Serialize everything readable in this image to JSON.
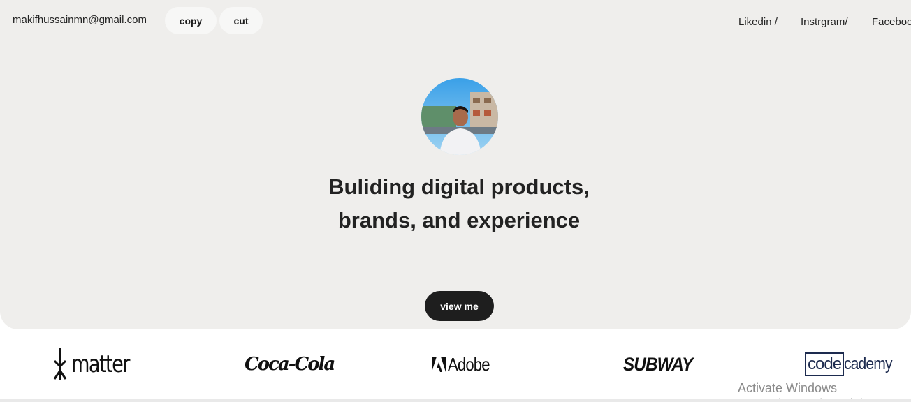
{
  "header": {
    "email": "makifhussainmn@gmail.com",
    "copy_label": "copy",
    "cut_label": "cut",
    "social": {
      "linkedin": "Likedin /",
      "instagram": "Instrgram/",
      "facebook": "Facebook"
    }
  },
  "hero": {
    "headline": "Buliding digital products, brands, and experience",
    "cta_label": "view me"
  },
  "logos": {
    "matter": "matter",
    "cocacola": "Coca-Cola",
    "adobe": "Adobe",
    "subway": "SUBWAY",
    "codecademy_box": "code",
    "codecademy_rest": "cademy"
  },
  "os_overlay": {
    "title": "Activate Windows",
    "subtitle": "Go to Settings to activate Windows."
  },
  "colors": {
    "hero_background": "#efeeec",
    "button_dark": "#1e1e1e",
    "pill_background": "#f7f7f6"
  }
}
